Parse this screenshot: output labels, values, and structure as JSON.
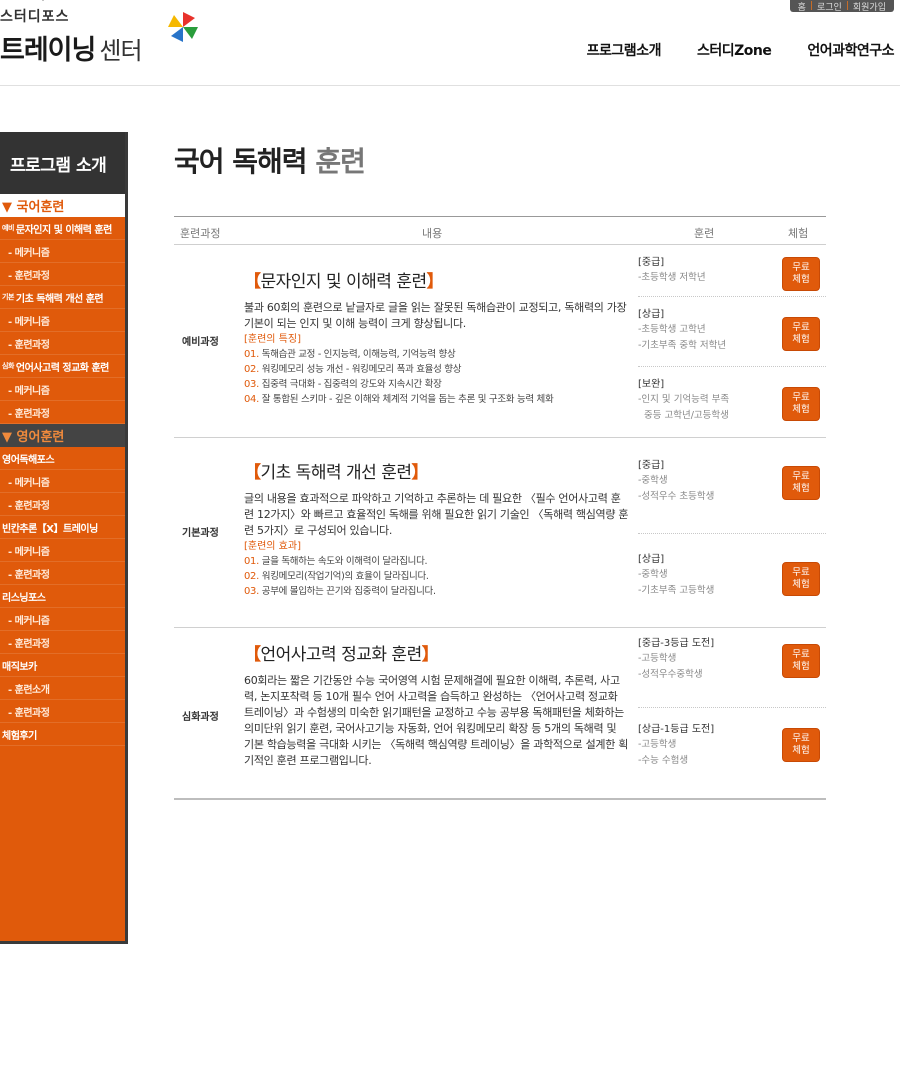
{
  "header": {
    "logo_sub": "스터디포스",
    "logo_main": "트레이닝",
    "logo_main_light": "센터",
    "util_links": [
      "홈",
      "로그인",
      "회원가입"
    ],
    "gnb": [
      "프로그램소개",
      "스터디Zone",
      "언어과학연구소"
    ]
  },
  "sidebar": {
    "title": "프로그램 소개",
    "korean_group": "▼ 국어훈련",
    "k1_prefix": "예비",
    "k1_label": "문자인지 및 이해력 훈련",
    "k1_sub1": "- 메커니즘",
    "k1_sub2": "- 훈련과정",
    "k2_prefix": "기본",
    "k2_label": "기초 독해력 개선 훈련",
    "k2_sub1": "- 메커니즘",
    "k2_sub2": "- 훈련과정",
    "k3_prefix": "심화",
    "k3_label": "언어사고력 정교화 훈련",
    "k3_sub1": "- 메커니즘",
    "k3_sub2": "- 훈련과정",
    "english_group": "▼ 영어훈련",
    "e1_label": "영어독해포스",
    "e1_sub1": "- 메커니즘",
    "e1_sub2": "- 훈련과정",
    "e2_label": "빈칸추론【X】트레이닝",
    "e2_sub1": "- 메커니즘",
    "e2_sub2": "- 훈련과정",
    "e3_label": "리스닝포스",
    "e3_sub1": "- 메커니즘",
    "e3_sub2": "- 훈련과정",
    "e4_label": "매직보카",
    "e4_sub1": "- 훈련소개",
    "e4_sub2": "- 훈련과정",
    "review": "체험후기"
  },
  "main": {
    "title": "국어 독해력",
    "title_grey": "훈련",
    "columns": {
      "course": "훈련과정",
      "content": "내용",
      "training": "훈련",
      "trial": "체험"
    },
    "try_l1": "무료",
    "try_l2": "체험",
    "r1": {
      "label": "예비과정",
      "title_open": "【",
      "title": "문자인지 및 이해력 훈련",
      "title_close": "】",
      "desc": "불과 60회의 훈련으로 낱글자로 글을 읽는 잘못된 독해습관이 교정되고, 독해력의 가장 기본이 되는 인지 및 이해 능력이 크게 향상됩니다.",
      "feat_head": "[훈련의 특징]",
      "f1n": "01.",
      "f1": "독해습관 교정 - 인지능력, 이해능력, 기억능력 향상",
      "f2n": "02.",
      "f2": "워킹메모리 성능 개선 - 워킹메모리 폭과 효율성 향상",
      "f3n": "03.",
      "f3": "집중력 극대화 - 집중력의 강도와 지속시간 확장",
      "f4n": "04.",
      "f4": "잘 통합된 스키마 - 깊은 이해와 체계적 기억을 돕는 추론 및 구조화 능력 체화",
      "l1_name": "[중급]",
      "l1_d1": "-초등학생 저학년",
      "l2_name": "[상급]",
      "l2_d1": "-초등학생 고학년",
      "l2_d2": "-기초부족 중학 저학년",
      "l3_name": "[보완]",
      "l3_d1": "-인지 및 기억능력 부족",
      "l3_d2": "중등 고학년/고등학생"
    },
    "r2": {
      "label": "기본과정",
      "title_open": "【",
      "title": "기초 독해력 개선 훈련",
      "title_close": "】",
      "desc": "글의 내용을 효과적으로 파악하고 기억하고 추론하는 데 필요한 〈필수 언어사고력 훈련 12가지〉와 빠르고 효율적인 독해를 위해 필요한 읽기 기술인 〈독해력 핵심역량 훈련 5가지〉로 구성되어 있습니다.",
      "feat_head": "[훈련의 효과]",
      "f1n": "01.",
      "f1": "글을 독해하는 속도와 이해력이 달라집니다.",
      "f2n": "02.",
      "f2": "워킹메모리(작업기억)의 효율이 달라집니다.",
      "f3n": "03.",
      "f3": "공부에 몰입하는 끈기와 집중력이 달라집니다.",
      "l1_name": "[중급]",
      "l1_d1": "-중학생",
      "l1_d2": "-성적우수 초등학생",
      "l2_name": "[상급]",
      "l2_d1": "-중학생",
      "l2_d2": "-기초부족 고등학생"
    },
    "r3": {
      "label": "심화과정",
      "title_open": "【",
      "title": "언어사고력 정교화 훈련",
      "title_close": "】",
      "desc": "60회라는 짧은 기간동안 수능 국어영역 시험 문제해결에 필요한 이해력, 추론력, 사고력, 논지포착력 등 10개 필수 언어 사고력을 습득하고 완성하는 〈언어사고력 정교화 트레이닝〉과 수험생의 미숙한 읽기패턴을 교정하고 수능 공부용 독해패턴을 체화하는 의미단위 읽기 훈련, 국어사고기능 자동화, 언어 워킹메모리 확장 등 5개의 독해력 및 기본 학습능력을 극대화 시키는 〈독해력 핵심역량 트레이닝〉을 과학적으로 설계한 획기적인 훈련 프로그램입니다.",
      "l1_name": "[중급-3등급 도전]",
      "l1_d1": "-고등학생",
      "l1_d2": "-성적우수중학생",
      "l2_name": "[상급-1등급 도전]",
      "l2_d1": "-고등학생",
      "l2_d2": "-수능 수험생"
    }
  },
  "colors": {
    "accent": "#e05a0b",
    "sidebar_head": "#333333"
  }
}
